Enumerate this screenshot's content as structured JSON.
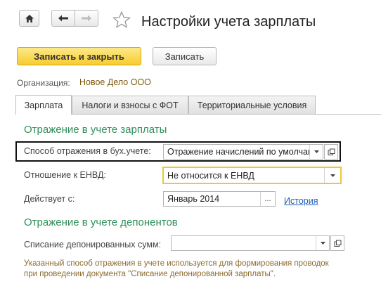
{
  "window": {
    "title": "Настройки учета зарплаты"
  },
  "toolbar": {
    "save_close_label": "Записать и закрыть",
    "save_label": "Записать"
  },
  "organization": {
    "label": "Организация:",
    "value": "Новое Дело ООО"
  },
  "tabs": [
    {
      "label": "Зарплата",
      "active": true
    },
    {
      "label": "Налоги и взносы с ФОТ",
      "active": false
    },
    {
      "label": "Территориальные условия",
      "active": false
    }
  ],
  "salary_section": {
    "title": "Отражение в учете зарплаты",
    "method": {
      "label": "Способ отражения в бух.учете:",
      "value": "Отражение начислений по умолчанию"
    },
    "envd": {
      "label": "Отношение к ЕНВД:",
      "value": "Не относится к ЕНВД"
    },
    "effective": {
      "label": "Действует с:",
      "value": "Январь 2014",
      "more": "...",
      "history_link": "История"
    }
  },
  "deposit_section": {
    "title": "Отражение в учете депонентов",
    "writeoff": {
      "label": "Списание депонированных сумм:",
      "value": ""
    },
    "note_line1": "Указанный способ отражения в учете используется для формирования проводок",
    "note_line2": "при проведении документа \"Списание депонированной зарплаты\"."
  },
  "colors": {
    "accent": "#f6cc2e",
    "section": "#2f8f5a",
    "link": "#1a5fb4",
    "note": "#8a6a2f"
  }
}
